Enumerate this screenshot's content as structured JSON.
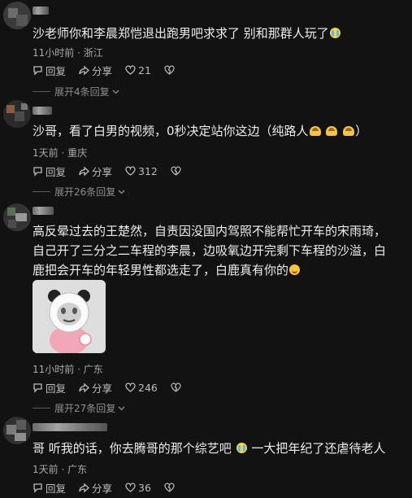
{
  "comments": [
    {
      "text": "沙老师你和李晨郑恺退出跑男吧求求了 别和那群人玩了",
      "time": "11小时前",
      "location": "浙江",
      "reply_label": "回复",
      "share_label": "分享",
      "likes": "21",
      "expand_label": "展开4条回复"
    },
    {
      "text": "沙哥，看了白男的视频，0秒决定站你这边（纯路人",
      "text_end": "）",
      "time": "1天前",
      "location": "重庆",
      "reply_label": "回复",
      "share_label": "分享",
      "likes": "312",
      "expand_label": "展开26条回复"
    },
    {
      "lines": [
        "高反晕过去的王楚然，自责因没国内驾照不能帮忙开车的宋雨琦，",
        "自己开了三分之二车程的李晨，边吸氧边开完剩下车程的沙溢，白",
        "鹿把会开车的年轻男性都选走了，白鹿真有你的"
      ],
      "time": "11小时前",
      "location": "广东",
      "reply_label": "回复",
      "share_label": "分享",
      "likes": "246",
      "expand_label": "展开27条回复"
    },
    {
      "text": "哥 听我的话，你去腾哥的那个综艺吧",
      "text_end": "一大把年纪了还虐待老人",
      "time": "1天前",
      "location": "广东",
      "reply_label": "回复",
      "share_label": "分享",
      "likes": "36"
    }
  ],
  "icons": {
    "reply": "speech-bubble-icon",
    "share": "share-arrow-icon",
    "like": "heart-icon",
    "dislike": "broken-heart-icon",
    "emoji_cry": "crying-face-emoji",
    "emoji_bow": "bowing-emoji",
    "emoji_smile": "smiling-face-emoji"
  },
  "colors": {
    "background": "#121212",
    "text": "#ededed",
    "meta": "#9a9a9a"
  }
}
